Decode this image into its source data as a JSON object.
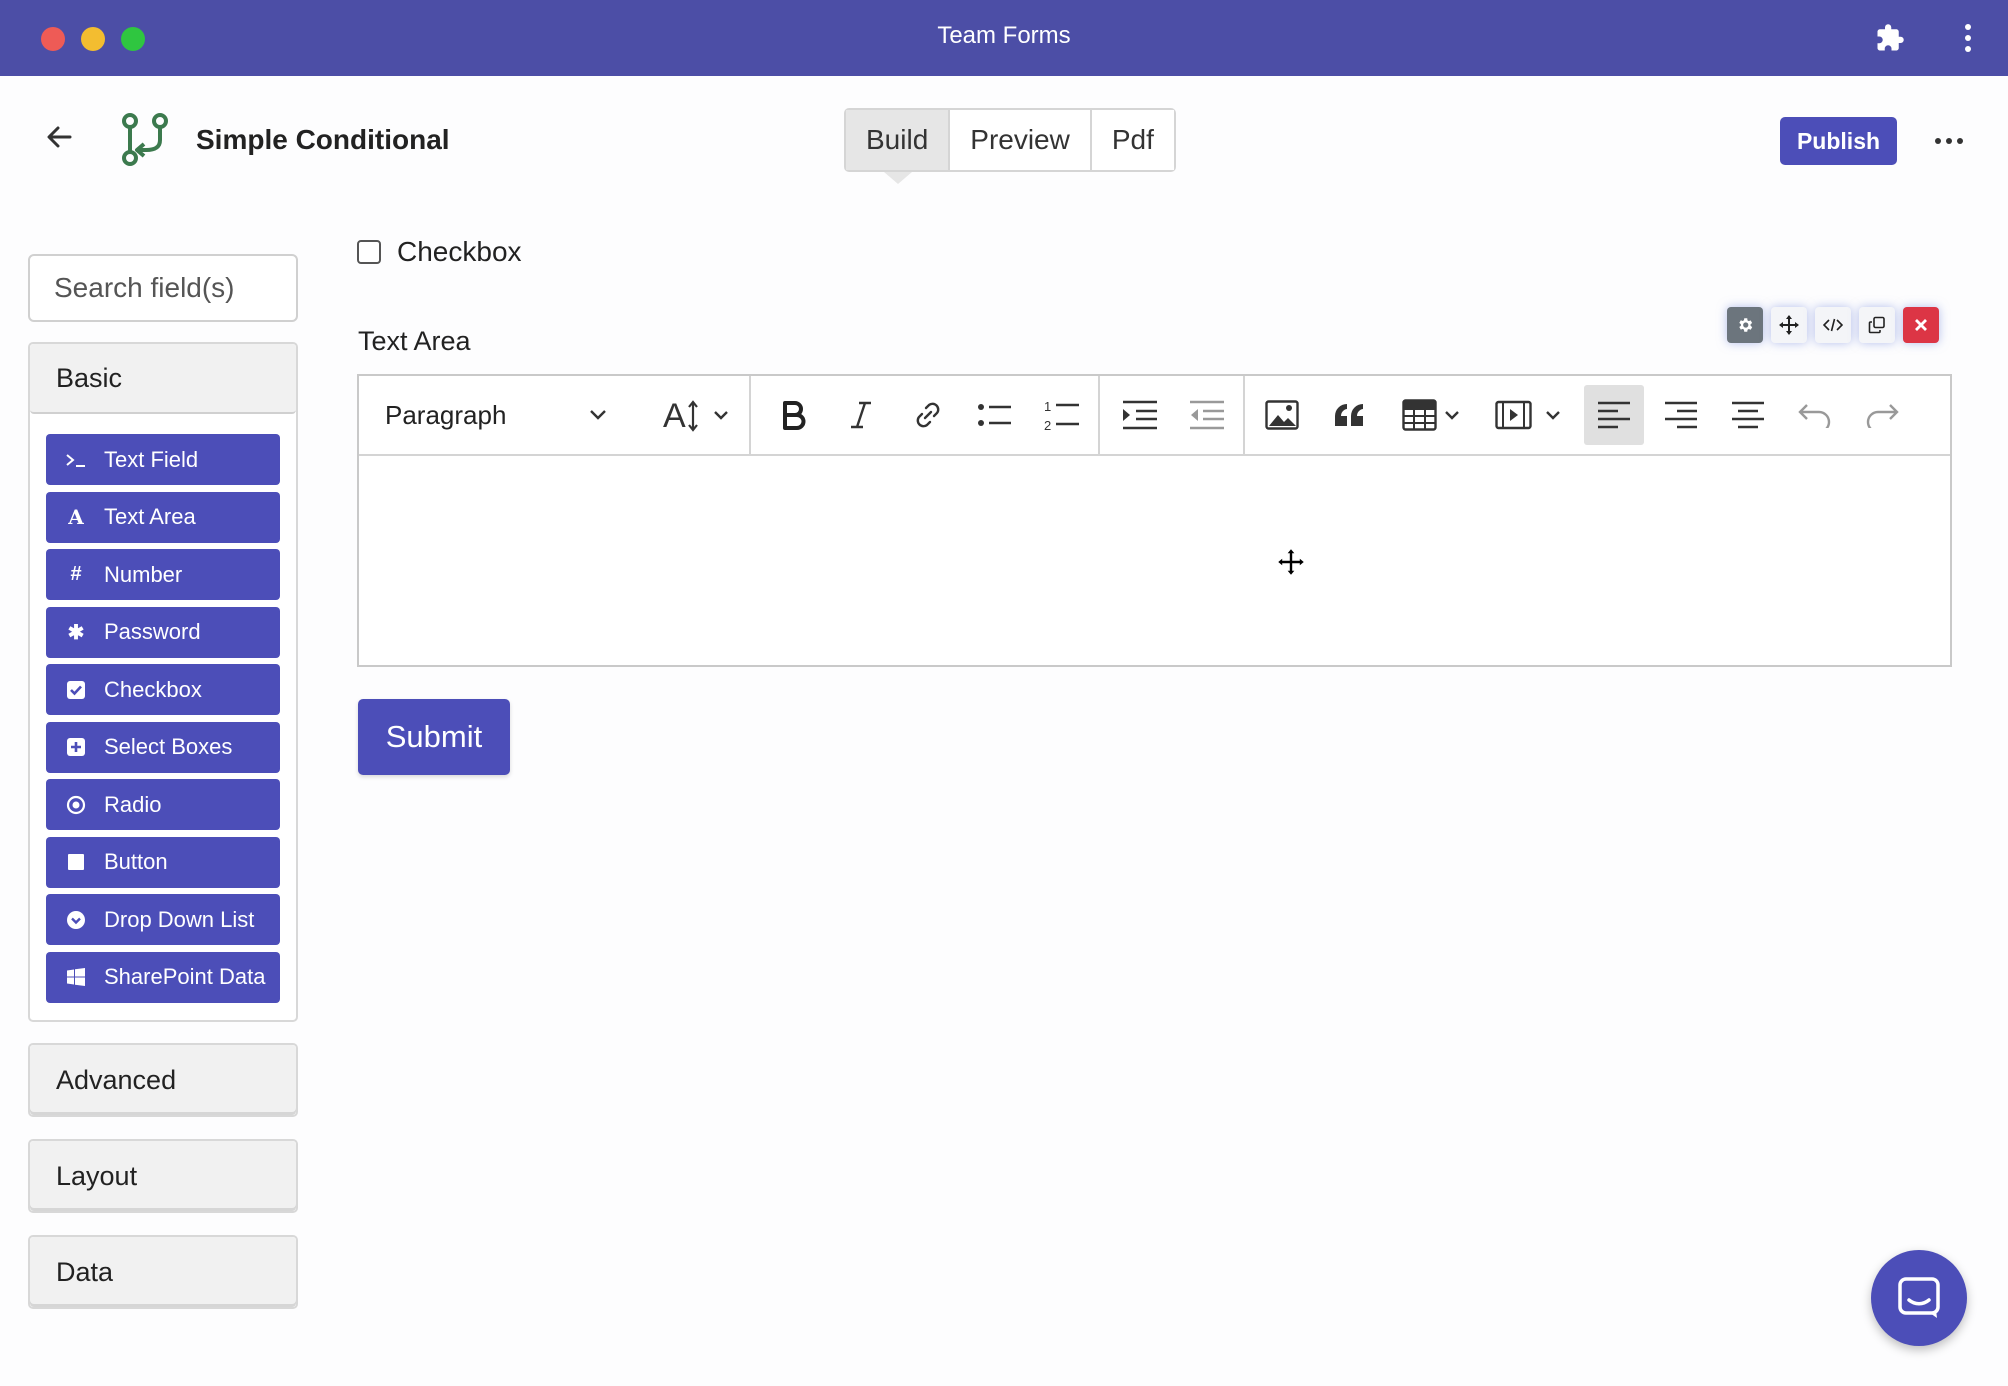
{
  "window": {
    "title": "Team Forms"
  },
  "header": {
    "form_title": "Simple Conditional",
    "tabs": [
      {
        "label": "Build",
        "active": true
      },
      {
        "label": "Preview",
        "active": false
      },
      {
        "label": "Pdf",
        "active": false
      }
    ],
    "publish_label": "Publish"
  },
  "sidebar": {
    "search_placeholder": "Search field(s)",
    "groups": [
      {
        "label": "Basic",
        "expanded": true,
        "items": [
          {
            "label": "Text Field",
            "icon": "terminal-icon"
          },
          {
            "label": "Text Area",
            "icon": "font-icon"
          },
          {
            "label": "Number",
            "icon": "hashtag-icon"
          },
          {
            "label": "Password",
            "icon": "asterisk-icon"
          },
          {
            "label": "Checkbox",
            "icon": "check-square-icon"
          },
          {
            "label": "Select Boxes",
            "icon": "plus-square-icon"
          },
          {
            "label": "Radio",
            "icon": "dot-circle-icon"
          },
          {
            "label": "Button",
            "icon": "stop-icon"
          },
          {
            "label": "Drop Down List",
            "icon": "chevron-circle-down-icon"
          },
          {
            "label": "SharePoint Data",
            "icon": "windows-icon"
          }
        ]
      },
      {
        "label": "Advanced",
        "expanded": false
      },
      {
        "label": "Layout",
        "expanded": false
      },
      {
        "label": "Data",
        "expanded": false
      }
    ]
  },
  "form": {
    "checkbox_label": "Checkbox",
    "textarea_label": "Text Area",
    "editor": {
      "paragraph_select": "Paragraph",
      "toolbar_icons": [
        "font-size-icon",
        "bold-icon",
        "italic-icon",
        "link-icon",
        "bulleted-list-icon",
        "numbered-list-icon",
        "indent-icon",
        "outdent-icon",
        "image-icon",
        "blockquote-icon",
        "table-icon",
        "media-icon",
        "align-left-icon",
        "align-right-icon",
        "align-center-icon",
        "undo-icon",
        "redo-icon"
      ],
      "active_alignment": "left"
    },
    "submit_label": "Submit"
  },
  "colors": {
    "titlebar": "#4c4ea6",
    "primary": "#4c4eb8",
    "danger": "#dc3545"
  }
}
